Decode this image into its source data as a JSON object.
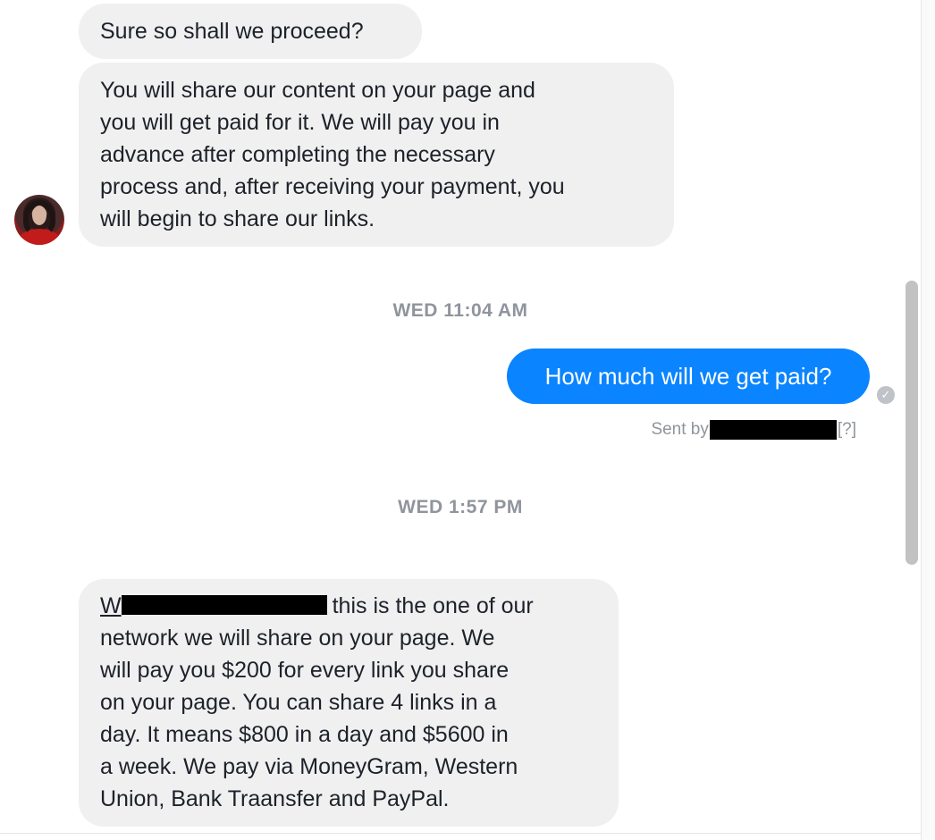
{
  "messages": {
    "incoming_1": {
      "lines": [
        "Sure so shall we proceed?"
      ]
    },
    "incoming_2": {
      "lines": [
        "You will share our content on your page and",
        "you will get paid for it. We will pay you in",
        "advance after completing the necessary",
        "process and, after receiving your payment, you",
        "will begin to share our links."
      ]
    },
    "timestamp_1": "WED 11:04 AM",
    "outgoing_1": "How much will we get paid?",
    "sent_by": {
      "prefix": "Sent by",
      "suffix": "[?]"
    },
    "timestamp_2": "WED 1:57 PM",
    "incoming_3": {
      "link_initial": "W",
      "first_line_rest": "this is the one of our",
      "lines": [
        "network we will share on your page. We",
        "will pay you $200 for every link you share",
        "on your page. You can share 4 links in a",
        "day. It means $800 in a day and $5600 in",
        "a week. We pay via MoneyGram, Western",
        "Union, Bank Traansfer and PayPal."
      ]
    }
  },
  "colors": {
    "outgoing_bubble": "#0a84ff",
    "incoming_bubble": "#f0f0f0",
    "timestamp_text": "#90949c"
  },
  "icons": {
    "delivered": "check-circle-icon",
    "avatar": "contact-avatar"
  }
}
